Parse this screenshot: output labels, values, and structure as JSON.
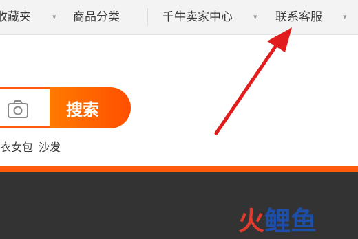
{
  "topnav": {
    "items": [
      {
        "label": "收藏夹",
        "has_caret": true
      },
      {
        "label": "商品分类",
        "has_caret": false
      },
      {
        "label": "千牛卖家中心",
        "has_caret": true
      },
      {
        "label": "联系客服",
        "has_caret": true
      }
    ],
    "caret_icon": "chevron-down-icon"
  },
  "search": {
    "button_label": "搜索",
    "camera_icon": "camera-icon",
    "accent_color": "#ff5a0e"
  },
  "hotwords": [
    "毛衣女包",
    "沙发"
  ],
  "watermark": {
    "chars": [
      "火",
      "鲤",
      "鱼"
    ],
    "colors": [
      "#e23b2e",
      "#1e4fa8",
      "#1e4fa8"
    ]
  },
  "annotation": {
    "arrow_color": "#e11d1d"
  }
}
